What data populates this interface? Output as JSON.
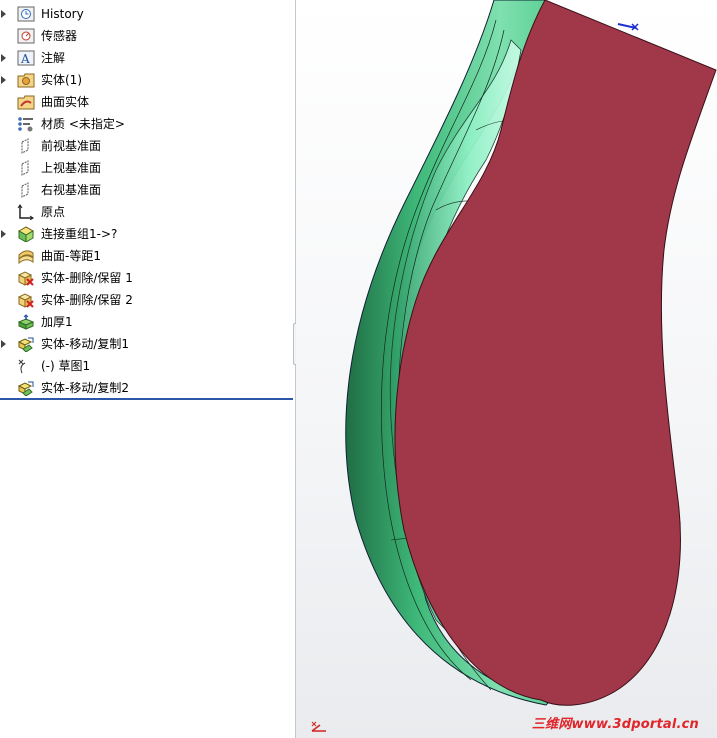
{
  "feature_tree": {
    "items": [
      {
        "label": "History",
        "icon": "history-icon",
        "expandable": true
      },
      {
        "label": "传感器",
        "icon": "sensor-icon",
        "expandable": false
      },
      {
        "label": "注解",
        "icon": "annotation-icon",
        "expandable": true
      },
      {
        "label": "实体(1)",
        "icon": "solid-bodies-icon",
        "expandable": true
      },
      {
        "label": "曲面实体",
        "icon": "surface-bodies-icon",
        "expandable": false
      },
      {
        "label": "材质 <未指定>",
        "icon": "material-icon",
        "expandable": false
      },
      {
        "label": "前视基准面",
        "icon": "plane-icon",
        "expandable": false
      },
      {
        "label": "上视基准面",
        "icon": "plane-icon",
        "expandable": false
      },
      {
        "label": "右视基准面",
        "icon": "plane-icon",
        "expandable": false
      },
      {
        "label": "原点",
        "icon": "origin-icon",
        "expandable": false
      },
      {
        "label": "连接重组1->?",
        "icon": "knit-icon",
        "expandable": true
      },
      {
        "label": "曲面-等距1",
        "icon": "offset-surface-icon",
        "expandable": false
      },
      {
        "label": "实体-删除/保留 1",
        "icon": "delete-body-icon",
        "expandable": false
      },
      {
        "label": "实体-删除/保留 2",
        "icon": "delete-body-icon",
        "expandable": false
      },
      {
        "label": "加厚1",
        "icon": "thicken-icon",
        "expandable": false
      },
      {
        "label": "实体-移动/复制1",
        "icon": "move-copy-icon",
        "expandable": true
      },
      {
        "label": "(-) 草图1",
        "icon": "sketch-icon",
        "expandable": false
      },
      {
        "label": "实体-移动/复制2",
        "icon": "move-copy-icon",
        "expandable": false
      }
    ]
  },
  "watermark": "三维网www.3dportal.cn",
  "colors": {
    "model_face": "#a0384a",
    "model_body": "#3fb97a",
    "rollback_bar": "#2a57a8",
    "watermark": "#e0262b"
  }
}
